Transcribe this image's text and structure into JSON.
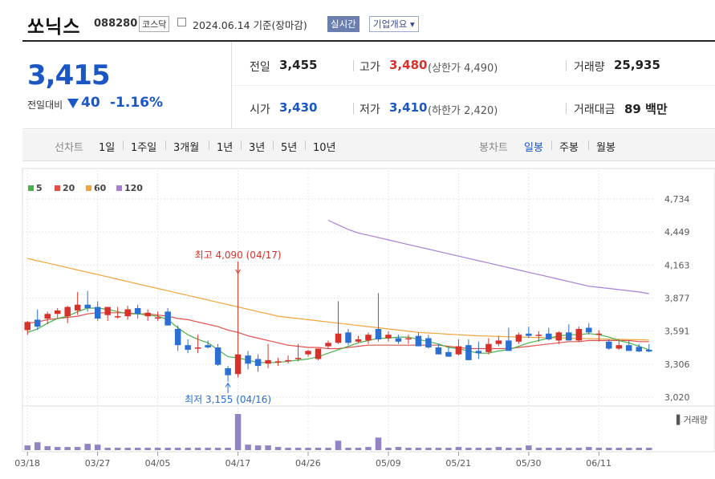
{
  "header": {
    "name": "쏘닉스",
    "code": "088280",
    "market": "코스닥",
    "date": "2024.06.14 기준(장마감)",
    "realtime": "실시간",
    "corp_info": "기업개요 ▾"
  },
  "summary": {
    "price": "3,415",
    "change_label": "전일대비",
    "change_amount": "40",
    "change_pct": "-1.16%",
    "prev_close_label": "전일",
    "prev_close": "3,455",
    "high_label": "고가",
    "high": "3,480",
    "upper_limit": "(상한가 4,490)",
    "volume_label": "거래량",
    "volume": "25,935",
    "open_label": "시가",
    "open": "3,430",
    "low_label": "저가",
    "low": "3,410",
    "lower_limit": "(하한가 2,420)",
    "value_label": "거래대금",
    "value": "89 백만"
  },
  "period_tabs": {
    "label": "선차트",
    "items": [
      "1일",
      "1주일",
      "3개월",
      "1년",
      "3년",
      "5년",
      "10년"
    ]
  },
  "candle_tabs": {
    "label": "봉차트",
    "items": [
      "일봉",
      "주봉",
      "월봉"
    ],
    "active": "일봉"
  },
  "colors": {
    "up": "#d8312a",
    "down": "#2a6fd1",
    "ma5": "#49b14a",
    "ma20": "#e0504a",
    "ma60": "#f2a33a",
    "ma120": "#a77ed6",
    "volume": "#9183c4",
    "price_blue": "#1a56c4"
  },
  "chart_data": {
    "type": "candlestick",
    "title": "",
    "legend": [
      "5",
      "20",
      "60",
      "120"
    ],
    "y_ticks": [
      "4,734",
      "4,449",
      "4,163",
      "3,877",
      "3,591",
      "3,306",
      "3,020"
    ],
    "ylim": [
      3020,
      4734
    ],
    "volume_label": "▌거래량",
    "x_ticks": [
      {
        "i": 0,
        "label": "03/18"
      },
      {
        "i": 7,
        "label": "03/27"
      },
      {
        "i": 13,
        "label": "04/05"
      },
      {
        "i": 21,
        "label": "04/17"
      },
      {
        "i": 28,
        "label": "04/26"
      },
      {
        "i": 36,
        "label": "05/09"
      },
      {
        "i": 43,
        "label": "05/21"
      },
      {
        "i": 50,
        "label": "05/30"
      },
      {
        "i": 57,
        "label": "06/11"
      }
    ],
    "high_annotation": {
      "text": "최고 4,090 (04/17)",
      "index": 21,
      "value": 4090
    },
    "low_annotation": {
      "text": "최저 3,155 (04/16)",
      "index": 20,
      "value": 3155
    },
    "candles": [
      [
        3600,
        3680,
        3560,
        3670
      ],
      [
        3690,
        3780,
        3600,
        3630
      ],
      [
        3700,
        3760,
        3650,
        3740
      ],
      [
        3740,
        3790,
        3700,
        3770
      ],
      [
        3720,
        3810,
        3660,
        3800
      ],
      [
        3770,
        3930,
        3730,
        3820
      ],
      [
        3820,
        3940,
        3760,
        3790
      ],
      [
        3800,
        3850,
        3680,
        3700
      ],
      [
        3730,
        3800,
        3680,
        3800
      ],
      [
        3710,
        3800,
        3700,
        3720
      ],
      [
        3720,
        3810,
        3690,
        3780
      ],
      [
        3790,
        3820,
        3700,
        3740
      ],
      [
        3720,
        3780,
        3680,
        3750
      ],
      [
        3700,
        3760,
        3680,
        3710
      ],
      [
        3760,
        3790,
        3640,
        3640
      ],
      [
        3610,
        3640,
        3420,
        3470
      ],
      [
        3470,
        3520,
        3400,
        3430
      ],
      [
        3440,
        3560,
        3400,
        3450
      ],
      [
        3470,
        3510,
        3440,
        3450
      ],
      [
        3450,
        3480,
        3290,
        3300
      ],
      [
        3270,
        3290,
        3155,
        3210
      ],
      [
        3220,
        4090,
        3190,
        3390
      ],
      [
        3380,
        3420,
        3260,
        3310
      ],
      [
        3350,
        3390,
        3240,
        3290
      ],
      [
        3310,
        3480,
        3270,
        3340
      ],
      [
        3320,
        3360,
        3290,
        3330
      ],
      [
        3340,
        3380,
        3310,
        3340
      ],
      [
        3360,
        3480,
        3330,
        3360
      ],
      [
        3390,
        3430,
        3370,
        3420
      ],
      [
        3350,
        3440,
        3340,
        3440
      ],
      [
        3460,
        3510,
        3440,
        3490
      ],
      [
        3490,
        3850,
        3480,
        3570
      ],
      [
        3580,
        3610,
        3470,
        3490
      ],
      [
        3500,
        3550,
        3490,
        3520
      ],
      [
        3510,
        3580,
        3480,
        3560
      ],
      [
        3610,
        3920,
        3500,
        3520
      ],
      [
        3530,
        3590,
        3500,
        3560
      ],
      [
        3530,
        3560,
        3480,
        3500
      ],
      [
        3520,
        3560,
        3480,
        3530
      ],
      [
        3550,
        3580,
        3460,
        3460
      ],
      [
        3530,
        3560,
        3440,
        3450
      ],
      [
        3450,
        3480,
        3390,
        3390
      ],
      [
        3410,
        3450,
        3370,
        3370
      ],
      [
        3390,
        3520,
        3380,
        3460
      ],
      [
        3470,
        3520,
        3340,
        3340
      ],
      [
        3420,
        3500,
        3350,
        3400
      ],
      [
        3410,
        3530,
        3390,
        3480
      ],
      [
        3480,
        3550,
        3460,
        3510
      ],
      [
        3510,
        3620,
        3420,
        3420
      ],
      [
        3500,
        3580,
        3480,
        3560
      ],
      [
        3570,
        3630,
        3530,
        3550
      ],
      [
        3550,
        3590,
        3500,
        3560
      ],
      [
        3570,
        3620,
        3510,
        3520
      ],
      [
        3510,
        3590,
        3480,
        3580
      ],
      [
        3580,
        3650,
        3510,
        3510
      ],
      [
        3510,
        3630,
        3500,
        3610
      ],
      [
        3620,
        3660,
        3560,
        3580
      ],
      [
        3560,
        3600,
        3500,
        3570
      ],
      [
        3500,
        3520,
        3430,
        3440
      ],
      [
        3440,
        3520,
        3430,
        3470
      ],
      [
        3470,
        3510,
        3430,
        3420
      ],
      [
        3455,
        3480,
        3410,
        3415
      ],
      [
        3430,
        3480,
        3410,
        3415
      ]
    ],
    "volume": [
      6,
      10,
      5,
      4,
      4,
      4,
      8,
      7,
      3,
      3,
      3,
      3,
      3,
      3,
      3,
      3,
      3,
      3,
      3,
      3,
      3,
      46,
      7,
      6,
      6,
      4,
      3,
      3,
      3,
      3,
      3,
      12,
      3,
      3,
      4,
      16,
      3,
      4,
      3,
      3,
      3,
      3,
      3,
      4,
      3,
      3,
      3,
      4,
      3,
      3,
      6,
      3,
      3,
      3,
      3,
      3,
      4,
      3,
      3,
      3,
      3,
      3,
      3
    ],
    "ma": {
      "ma5": [
        3580,
        3610,
        3660,
        3700,
        3720,
        3760,
        3790,
        3790,
        3780,
        3760,
        3740,
        3740,
        3730,
        3720,
        3690,
        3620,
        3560,
        3520,
        3490,
        3430,
        3370,
        3360,
        3340,
        3320,
        3320,
        3320,
        3330,
        3340,
        3350,
        3370,
        3400,
        3430,
        3460,
        3490,
        3510,
        3530,
        3530,
        3540,
        3540,
        3520,
        3500,
        3480,
        3450,
        3440,
        3420,
        3400,
        3400,
        3420,
        3430,
        3460,
        3490,
        3510,
        3530,
        3550,
        3560,
        3560,
        3570,
        3560,
        3540,
        3510,
        3490,
        3460,
        3430
      ],
      "ma20": [
        3660,
        3670,
        3690,
        3700,
        3710,
        3720,
        3740,
        3750,
        3750,
        3750,
        3750,
        3740,
        3740,
        3730,
        3720,
        3700,
        3690,
        3670,
        3650,
        3630,
        3600,
        3580,
        3550,
        3530,
        3510,
        3490,
        3470,
        3460,
        3450,
        3450,
        3440,
        3440,
        3450,
        3460,
        3470,
        3470,
        3470,
        3470,
        3470,
        3470,
        3470,
        3470,
        3460,
        3450,
        3440,
        3440,
        3440,
        3440,
        3440,
        3450,
        3460,
        3470,
        3480,
        3490,
        3500,
        3500,
        3510,
        3510,
        3510,
        3510,
        3510,
        3500,
        3500
      ],
      "ma60": [
        4220,
        4200,
        4180,
        4160,
        4140,
        4120,
        4100,
        4080,
        4060,
        4040,
        4020,
        4000,
        3980,
        3960,
        3940,
        3920,
        3900,
        3880,
        3860,
        3840,
        3820,
        3800,
        3780,
        3760,
        3740,
        3720,
        3710,
        3700,
        3690,
        3680,
        3670,
        3660,
        3650,
        3640,
        3630,
        3620,
        3610,
        3600,
        3590,
        3580,
        3575,
        3570,
        3565,
        3560,
        3555,
        3550,
        3548,
        3545,
        3542,
        3540,
        3538,
        3536,
        3534,
        3532,
        3530,
        3528,
        3526,
        3524,
        3522,
        3520,
        3518,
        3516,
        3514
      ],
      "ma120_start": 30,
      "ma120": [
        4550,
        4510,
        4470,
        4440,
        4420,
        4400,
        4380,
        4360,
        4340,
        4320,
        4300,
        4280,
        4260,
        4240,
        4220,
        4200,
        4180,
        4160,
        4140,
        4120,
        4100,
        4080,
        4060,
        4040,
        4020,
        4000,
        3980,
        3970,
        3960,
        3950,
        3940,
        3930,
        3915
      ]
    }
  }
}
